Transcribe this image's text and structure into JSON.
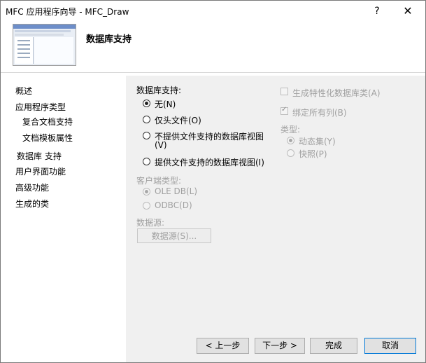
{
  "window": {
    "title": "MFC 应用程序向导 - MFC_Draw",
    "help": "?",
    "close": "✕"
  },
  "header": {
    "title": "数据库支持"
  },
  "nav": {
    "items": [
      "概述",
      "应用程序类型",
      "复合文档支持",
      "文档模板属性",
      "数据库 支持",
      "用户界面功能",
      "高级功能",
      "生成的类"
    ]
  },
  "db_support": {
    "label": "数据库支持:",
    "options": [
      {
        "text": "无(N)",
        "checked": true
      },
      {
        "text": "仅头文件(O)",
        "checked": false
      },
      {
        "text": "不提供文件支持的数据库视图",
        "text2": "(V)",
        "checked": false
      },
      {
        "text": "提供文件支持的数据库视图(I)",
        "checked": false
      }
    ]
  },
  "client_type": {
    "label": "客户端类型:",
    "options": [
      {
        "text": "OLE DB(L)",
        "checked": true
      },
      {
        "text": "ODBC(D)",
        "checked": false
      }
    ]
  },
  "datasource": {
    "label": "数据源:",
    "button": "数据源(S)..."
  },
  "right": {
    "generate_attr": "生成特性化数据库类(A)",
    "bind_all": "绑定所有列(B)",
    "type_label": "类型:",
    "type_options": [
      {
        "text": "动态集(Y)",
        "checked": true
      },
      {
        "text": "快照(P)",
        "checked": false
      }
    ]
  },
  "buttons": {
    "prev": "< 上一步",
    "next": "下一步 >",
    "finish": "完成",
    "cancel": "取消"
  }
}
